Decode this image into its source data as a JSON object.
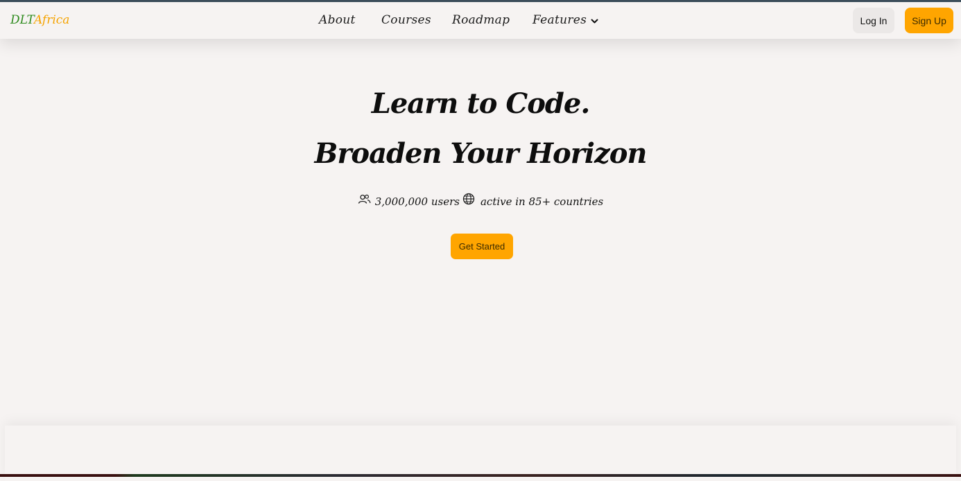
{
  "brand": {
    "part1": "DLT",
    "part2": "Africa",
    "color1": "#2e8b1e",
    "color2": "#f5a300"
  },
  "nav": {
    "links": [
      {
        "label": "About"
      },
      {
        "label": "Courses"
      },
      {
        "label": "Roadmap"
      },
      {
        "label": "Features",
        "icon": "chevron-down-icon"
      }
    ],
    "login_label": "Log In",
    "signup_label": "Sign Up"
  },
  "hero": {
    "title_line1": "Learn to Code.",
    "title_line2": "Broaden Your Horizon",
    "users_text": "3,000,000 users",
    "countries_text": "active in 85+ countries",
    "users_icon": "users-icon",
    "globe_icon": "globe-icon",
    "cta_label": "Get Started"
  },
  "colors": {
    "accent": "#ffa500",
    "background": "#f6f3f2",
    "topbar": "#3d4f5c"
  }
}
